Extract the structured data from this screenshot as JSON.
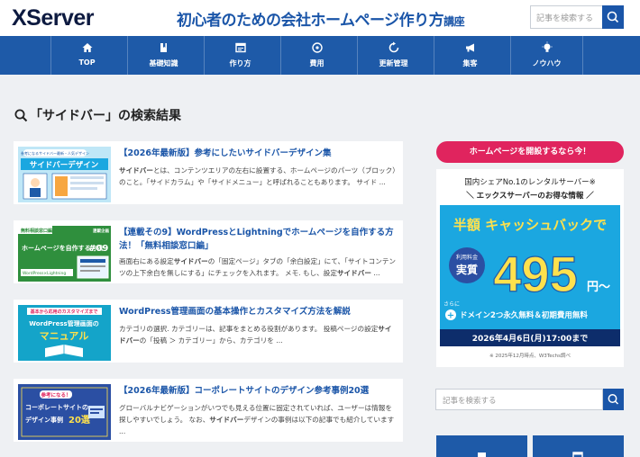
{
  "header": {
    "logo": "XServer",
    "site_title": "初心者のための会社ホームページ作り方",
    "site_title_suffix": "講座",
    "search_placeholder": "記事を検索する"
  },
  "nav": {
    "items": [
      {
        "label": "TOP",
        "icon": "home-icon"
      },
      {
        "label": "基礎知識",
        "icon": "book-icon"
      },
      {
        "label": "作り方",
        "icon": "window-icon"
      },
      {
        "label": "費用",
        "icon": "coin-icon"
      },
      {
        "label": "更新管理",
        "icon": "refresh-icon"
      },
      {
        "label": "集客",
        "icon": "megaphone-icon"
      },
      {
        "label": "ノウハウ",
        "icon": "lightbulb-icon"
      }
    ]
  },
  "search_result": {
    "heading": "「サイドバー」の検索結果"
  },
  "articles": [
    {
      "title": "【2026年最新版】参考にしたいサイドバーデザイン集",
      "desc_bold": "サイドバー",
      "desc": "とは、コンテンツエリアの左右に設置する、ホームページのパーツ（ブロック）のこと。「サイドカラム」や「サイドメニュー」と呼ばれることもあります。 サイド ...",
      "thumb_label": "サイドバーデザイン",
      "thumb_sub": "参考になるサイドバー最新・人気デザイン"
    },
    {
      "title": "【連載その9】WordPressとLightningでホームページを自作する方法！「無料相談窓口編」",
      "desc_pre": "画面右にある設定",
      "desc_bold": "サイドバー",
      "desc": "の「固定ページ」タブの「余白設定」にて、「サイトコンテンツの上下余白を無しにする」にチェックを入れます。 メモ. もし、設定",
      "desc_bold2": "サイドバー",
      "desc_post": " ...",
      "thumb_tag": "無料相談窓口編",
      "thumb_label": "ホームページを自作する方法",
      "thumb_num": "#09",
      "thumb_sub": "WordPress×Lightning",
      "thumb_badge": "連載企画"
    },
    {
      "title": "WordPress管理画面の基本操作とカスタマイズ方法を解説",
      "desc_pre": "カテゴリの選択. カテゴリーは、記事をまとめる役割があります。 投稿ページの設定",
      "desc_bold": "サイドバー",
      "desc": "の「投稿 ＞ カテゴリー」から、カテゴリを ...",
      "thumb_tag": "基本から応用のカスタマイズまで",
      "thumb_label": "WordPress管理画面の",
      "thumb_label2": "マニュアル"
    },
    {
      "title": "【2026年最新版】コーポレートサイトのデザイン参考事例20選",
      "desc_pre": "グローバルナビゲーションがいつでも見える位置に固定されていれば、ユーザーは情報を探しやすいでしょう。 なお、",
      "desc_bold": "サイドバー",
      "desc": "デザインの事例は以下の記事でも紹介しています ...",
      "thumb_tag": "参考になる！",
      "thumb_label": "コーポレートサイトの",
      "thumb_label2": "デザイン事例",
      "thumb_num": "20選"
    }
  ],
  "sidebar": {
    "banner_heading": "ホームページを開設するなら今！",
    "banner_line1": "国内シェアNo.1のレンタルサーバー※",
    "banner_line2": "＼ エックスサーバーのお得な情報 ／",
    "banner_badge": "半額 キャッシュバックで",
    "banner_price_label_1": "利用料金",
    "banner_price_label_2": "実質",
    "banner_price": "495",
    "banner_price_unit": "円〜",
    "banner_plus": "さらに",
    "banner_domain": "ドメイン2つ永久無料＆初期費用無料",
    "banner_date": "2026年4月6日(月)17:00まで",
    "banner_note": "※ 2025年12月時点、W3Techs調べ",
    "search_placeholder": "記事を検索する"
  },
  "colors": {
    "primary": "#1e5aa8",
    "accent": "#e0245e",
    "background": "#eef0f3"
  }
}
